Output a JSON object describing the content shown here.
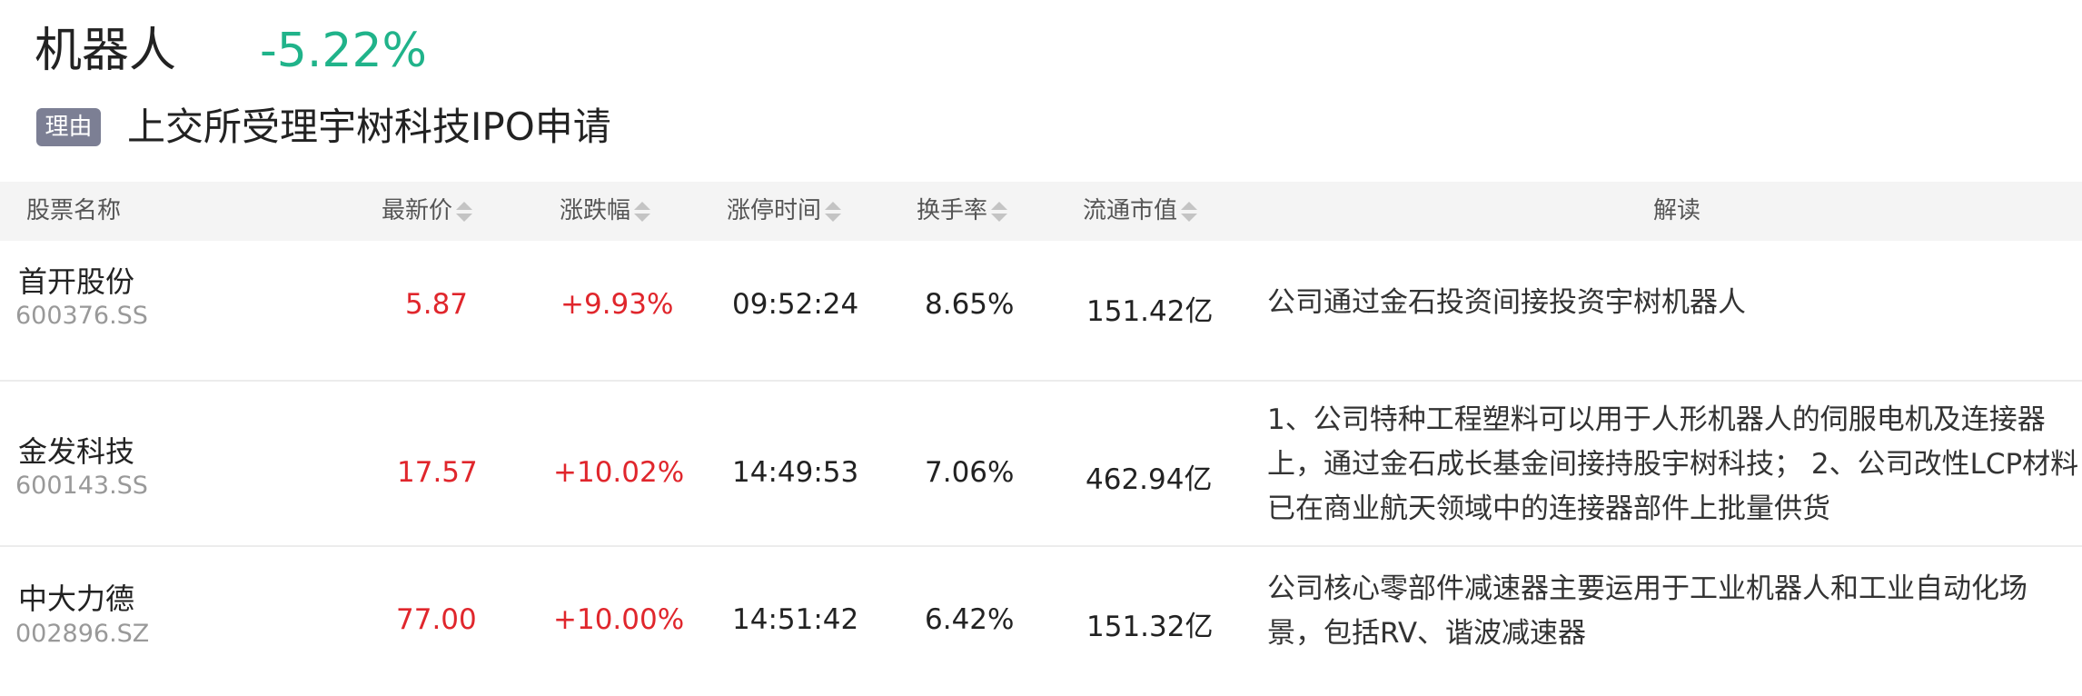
{
  "header": {
    "sector_name": "机器人",
    "sector_change": "-5.22%",
    "reason_tag": "理由",
    "reason_text": "上交所受理宇树科技IPO申请"
  },
  "colors": {
    "fall": "#20b38a",
    "rise": "#e0262c",
    "tag_bg": "#7c7f94",
    "header_bg": "#f4f4f4"
  },
  "table": {
    "columns": [
      "股票名称",
      "最新价",
      "涨跌幅",
      "涨停时间",
      "换手率",
      "流通市值",
      "解读"
    ],
    "rows": [
      {
        "name": "首开股份",
        "code": "600376.SS",
        "price": "5.87",
        "change": "+9.93%",
        "limit_time": "09:52:24",
        "turnover": "8.65%",
        "market_cap": "151.42亿",
        "interpretation": [
          "公司通过金石投资间接投资宇树机器人"
        ]
      },
      {
        "name": "金发科技",
        "code": "600143.SS",
        "price": "17.57",
        "change": "+10.02%",
        "limit_time": "14:49:53",
        "turnover": "7.06%",
        "market_cap": "462.94亿",
        "interpretation": [
          "1、公司特种工程塑料可以用于人形机器人的伺服电机及连接器",
          "上，通过金石成长基金间接持股宇树科技； 2、公司改性LCP材料",
          "已在商业航天领域中的连接器部件上批量供货"
        ]
      },
      {
        "name": "中大力德",
        "code": "002896.SZ",
        "price": "77.00",
        "change": "+10.00%",
        "limit_time": "14:51:42",
        "turnover": "6.42%",
        "market_cap": "151.32亿",
        "interpretation": [
          "公司核心零部件减速器主要运用于工业机器人和工业自动化场",
          "景，包括RV、谐波减速器"
        ]
      }
    ]
  }
}
